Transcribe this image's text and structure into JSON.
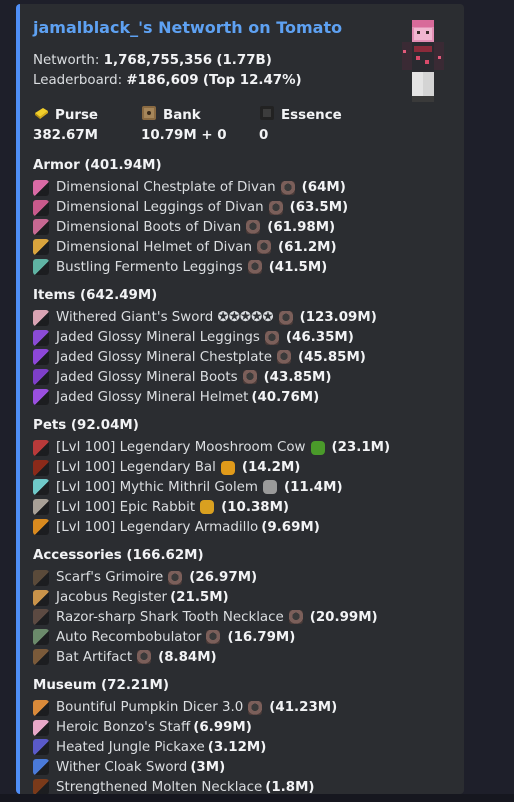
{
  "title": "jamalblack_'s Networth on Tomato",
  "networth": {
    "label": "Networth:",
    "value": "1,768,755,356",
    "short": "(1.77B)"
  },
  "leaderboard": {
    "label": "Leaderboard:",
    "value": "#186,609",
    "top": "(Top 12.47%)"
  },
  "stats": [
    {
      "label": "Purse",
      "value": "382.67M",
      "icon": "gold-ingot-icon",
      "color": "#e8c424"
    },
    {
      "label": "Bank",
      "value": "10.79M + 0",
      "icon": "bank-icon",
      "color": "#a68b5b"
    },
    {
      "label": "Essence",
      "value": "0",
      "icon": "essence-icon",
      "color": "#3a3a3a"
    }
  ],
  "sections": [
    {
      "title": "Armor (401.94M)",
      "items": [
        {
          "name": "Dimensional Chestplate of Divan",
          "rec": true,
          "value": "(64M)",
          "color": "#d96aa5"
        },
        {
          "name": "Dimensional Leggings of Divan",
          "rec": true,
          "value": "(63.5M)",
          "color": "#c85a8c"
        },
        {
          "name": "Dimensional Boots of Divan",
          "rec": true,
          "value": "(61.98M)",
          "color": "#c76892"
        },
        {
          "name": "Dimensional Helmet of Divan",
          "rec": true,
          "value": "(61.2M)",
          "color": "#d9a43d"
        },
        {
          "name": "Bustling Fermento Leggings",
          "rec": true,
          "value": "(41.5M)",
          "color": "#5fb3a3"
        }
      ]
    },
    {
      "title": "Items (642.49M)",
      "items": [
        {
          "name": "Withered Giant's Sword ✪✪✪✪✪",
          "rec": true,
          "value": "(123.09M)",
          "color": "#d9a3b3"
        },
        {
          "name": "Jaded Glossy Mineral Leggings",
          "rec": true,
          "value": "(46.35M)",
          "color": "#8a4bd6"
        },
        {
          "name": "Jaded Glossy Mineral Chestplate",
          "rec": true,
          "value": "(45.85M)",
          "color": "#8d47d9"
        },
        {
          "name": "Jaded Glossy Mineral Boots",
          "rec": true,
          "value": "(43.85M)",
          "color": "#7e3fc9"
        },
        {
          "name": "Jaded Glossy Mineral Helmet",
          "rec": false,
          "value": "(40.76M)",
          "color": "#9a4fe0"
        }
      ]
    },
    {
      "title": "Pets (92.04M)",
      "items": [
        {
          "name": "[Lvl 100] Legendary Mooshroom Cow",
          "rec": false,
          "extra": "green",
          "value": "(23.1M)",
          "color": "#b83a3a"
        },
        {
          "name": "[Lvl 100] Legendary Bal",
          "rec": false,
          "extra": "orange",
          "value": "(14.2M)",
          "color": "#8a2a1a"
        },
        {
          "name": "[Lvl 100] Mythic Mithril Golem",
          "rec": false,
          "extra": "grey",
          "value": "(11.4M)",
          "color": "#6fc9c9"
        },
        {
          "name": "[Lvl 100] Epic Rabbit",
          "rec": false,
          "extra": "gold",
          "value": "(10.38M)",
          "color": "#a8a097"
        },
        {
          "name": "[Lvl 100] Legendary Armadillo",
          "rec": false,
          "value": "(9.69M)",
          "color": "#d98a1f"
        }
      ]
    },
    {
      "title": "Accessories (166.62M)",
      "items": [
        {
          "name": "Scarf's Grimoire",
          "rec": true,
          "value": "(26.97M)",
          "color": "#5a4a3a"
        },
        {
          "name": "Jacobus Register",
          "rec": false,
          "value": "(21.5M)",
          "color": "#c9934a"
        },
        {
          "name": "Razor-sharp Shark Tooth Necklace",
          "rec": true,
          "value": "(20.99M)",
          "color": "#5c4a42"
        },
        {
          "name": "Auto Recombobulator",
          "rec": true,
          "value": "(16.79M)",
          "color": "#6b8a6b"
        },
        {
          "name": "Bat Artifact",
          "rec": true,
          "value": "(8.84M)",
          "color": "#7a5a3a"
        }
      ]
    },
    {
      "title": "Museum (72.21M)",
      "items": [
        {
          "name": "Bountiful Pumpkin Dicer 3.0",
          "rec": true,
          "value": "(41.23M)",
          "color": "#d98a3a"
        },
        {
          "name": "Heroic Bonzo's Staff",
          "rec": false,
          "value": "(6.99M)",
          "color": "#e8a8c8"
        },
        {
          "name": "Heated Jungle Pickaxe",
          "rec": false,
          "value": "(3.12M)",
          "color": "#5a5ac9"
        },
        {
          "name": "Wither Cloak Sword",
          "rec": false,
          "value": "(3M)",
          "color": "#4a7ad9"
        },
        {
          "name": "Strengthened Molten Necklace",
          "rec": false,
          "value": "(1.8M)",
          "color": "#7a3a1a"
        }
      ]
    }
  ]
}
